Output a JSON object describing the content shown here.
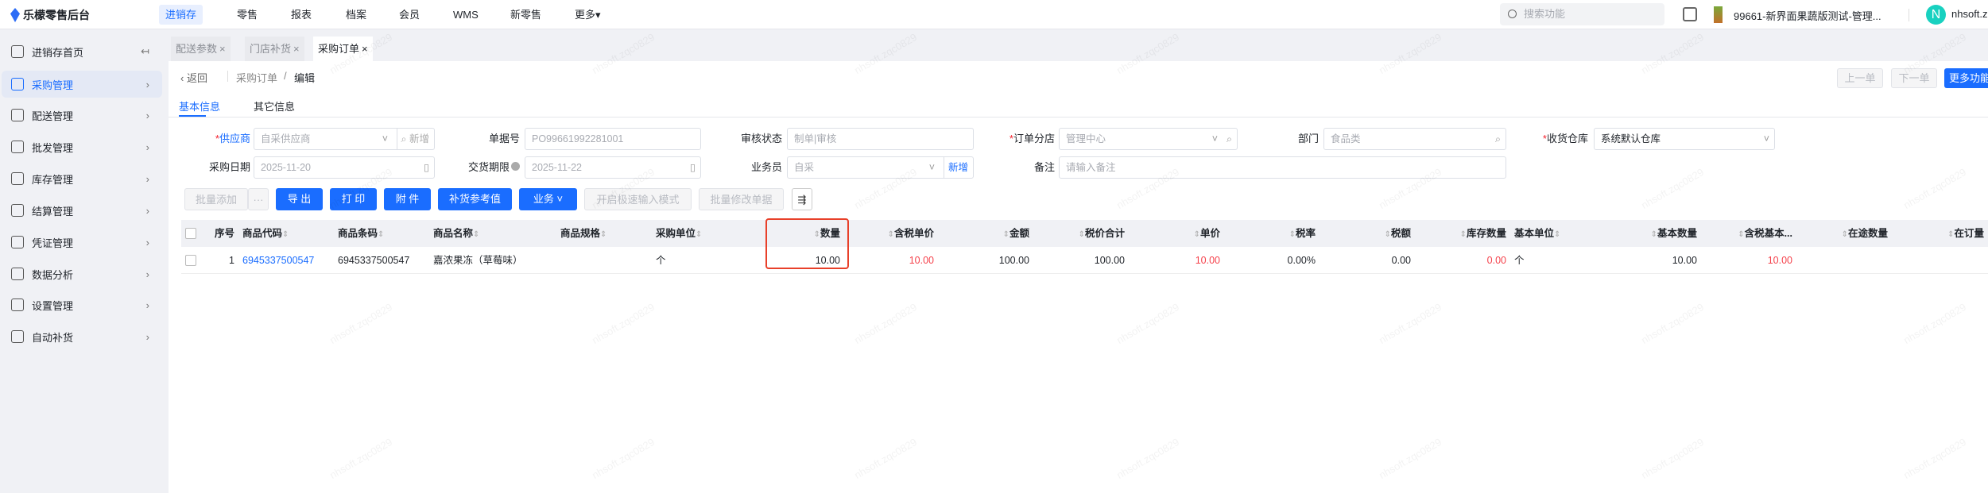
{
  "app": {
    "title": "乐檬零售后台"
  },
  "topnav": [
    "进销存",
    "零售",
    "报表",
    "档案",
    "会员",
    "WMS",
    "新零售",
    "更多▾"
  ],
  "header": {
    "search_placeholder": "搜索功能",
    "store": "99661-新界面果蔬版测试-管理...",
    "avatar": "N",
    "user": "nhsoft.z"
  },
  "sidebar": {
    "items": [
      {
        "label": "进销存首页",
        "chev": "↤"
      },
      {
        "label": "采购管理",
        "chev": "›"
      },
      {
        "label": "配送管理",
        "chev": "›"
      },
      {
        "label": "批发管理",
        "chev": "›"
      },
      {
        "label": "库存管理",
        "chev": "›"
      },
      {
        "label": "结算管理",
        "chev": "›"
      },
      {
        "label": "凭证管理",
        "chev": "›"
      },
      {
        "label": "数据分析",
        "chev": "›"
      },
      {
        "label": "设置管理",
        "chev": "›"
      },
      {
        "label": "自动补货",
        "chev": "›"
      }
    ]
  },
  "tabs": [
    {
      "label": "配送参数",
      "close": "×"
    },
    {
      "label": "门店补货",
      "close": "×"
    },
    {
      "label": "采购订单",
      "close": "×"
    }
  ],
  "page": {
    "back": "‹ 返回",
    "breadcrumb_parent": "采购订单",
    "breadcrumb_sep": "/",
    "breadcrumb_current": "编辑",
    "prev": "上一单",
    "next": "下一单",
    "more": "更多功能"
  },
  "subtabs": [
    "基本信息",
    "其它信息"
  ],
  "form": {
    "supplier": {
      "label": "供应商",
      "value": "自采供应商",
      "add": "新增"
    },
    "doc_no": {
      "label": "单据号",
      "value": "PO99661992281001"
    },
    "audit": {
      "label": "审核状态",
      "value": "制单|审核"
    },
    "branch": {
      "label": "订单分店",
      "value": "管理中心"
    },
    "dept": {
      "label": "部门",
      "value": "食品类"
    },
    "warehouse": {
      "label": "收货仓库",
      "value": "系统默认仓库"
    },
    "date": {
      "label": "采购日期",
      "value": "2025-11-20"
    },
    "deadline": {
      "label": "交货期限",
      "value": "2025-11-22"
    },
    "staff": {
      "label": "业务员",
      "value": "自采",
      "add": "新增"
    },
    "memo": {
      "label": "备注",
      "placeholder": "请输入备注"
    },
    "required_mark": "*"
  },
  "toolbar": {
    "batch_add": "批量添加",
    "more": "···",
    "export": "导 出",
    "print": "打 印",
    "attach": "附 件",
    "replenish": "补货参考值",
    "business": "业务 ˅",
    "fast_mode": "开启极速输入模式",
    "batch_edit": "批量修改单据",
    "column_icon": "⇶"
  },
  "table": {
    "columns": [
      "序号",
      "商品代码",
      "商品条码",
      "商品名称",
      "商品规格",
      "采购单位",
      "数量",
      "含税单价",
      "金额",
      "税价合计",
      "单价",
      "税率",
      "税额",
      "库存数量",
      "基本单位",
      "基本数量",
      "含税基本...",
      "在途数量",
      "在订量"
    ],
    "rows": [
      [
        "1",
        "6945337500547",
        "6945337500547",
        "嘉浓果冻（草莓味）",
        "",
        "个",
        "10.00",
        "10.00",
        "100.00",
        "100.00",
        "10.00",
        "0.00%",
        "0.00",
        "0.00",
        "个",
        "10.00",
        "10.00",
        "",
        ""
      ]
    ]
  },
  "colors": {
    "accent": "#1a6dff",
    "price_red": "#f5414b",
    "highlight_box": "#e8402a"
  },
  "watermark": "nhsoft.zqc0829"
}
